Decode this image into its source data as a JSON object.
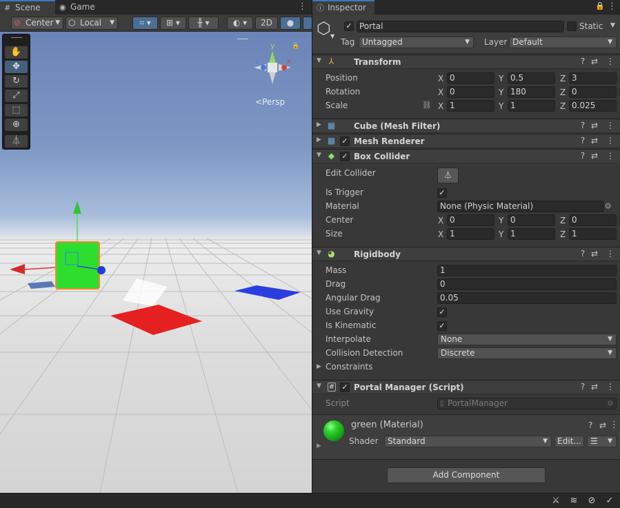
{
  "scene_tabs": {
    "scene": "Scene",
    "game": "Game"
  },
  "scene_toolbar": {
    "pivot": "Center",
    "space": "Local",
    "mode_2d": "2D"
  },
  "gizmo": {
    "view_label": "Persp",
    "y_axis": "y",
    "x_axis": "x",
    "z_axis": "z"
  },
  "inspector": {
    "tab": "Inspector",
    "object_name": "Portal",
    "static_label": "Static",
    "tag_label": "Tag",
    "tag_value": "Untagged",
    "layer_label": "Layer",
    "layer_value": "Default",
    "transform": {
      "title": "Transform",
      "position": {
        "label": "Position",
        "x": "0",
        "y": "0.5",
        "z": "3"
      },
      "rotation": {
        "label": "Rotation",
        "x": "0",
        "y": "180",
        "z": "0"
      },
      "scale": {
        "label": "Scale",
        "x": "1",
        "y": "1",
        "z": "0.025"
      }
    },
    "axes": {
      "x": "X",
      "y": "Y",
      "z": "Z"
    },
    "mesh_filter": {
      "title": "Cube (Mesh Filter)"
    },
    "mesh_renderer": {
      "title": "Mesh Renderer"
    },
    "box_collider": {
      "title": "Box Collider",
      "edit_collider": "Edit Collider",
      "is_trigger": "Is Trigger",
      "material_label": "Material",
      "material_value": "None (Physic Material)",
      "center": {
        "label": "Center",
        "x": "0",
        "y": "0",
        "z": "0"
      },
      "size": {
        "label": "Size",
        "x": "1",
        "y": "1",
        "z": "1"
      }
    },
    "rigidbody": {
      "title": "Rigidbody",
      "mass": {
        "label": "Mass",
        "value": "1"
      },
      "drag": {
        "label": "Drag",
        "value": "0"
      },
      "angular_drag": {
        "label": "Angular Drag",
        "value": "0.05"
      },
      "use_gravity": "Use Gravity",
      "is_kinematic": "Is Kinematic",
      "interpolate": {
        "label": "Interpolate",
        "value": "None"
      },
      "collision_detection": {
        "label": "Collision Detection",
        "value": "Discrete"
      },
      "constraints": "Constraints"
    },
    "portal_manager": {
      "title": "Portal Manager (Script)",
      "script_label": "Script",
      "script_value": "PortalManager"
    },
    "material": {
      "title": "green (Material)",
      "shader_label": "Shader",
      "shader_value": "Standard",
      "edit_button": "Edit..."
    },
    "add_component": "Add Component"
  }
}
